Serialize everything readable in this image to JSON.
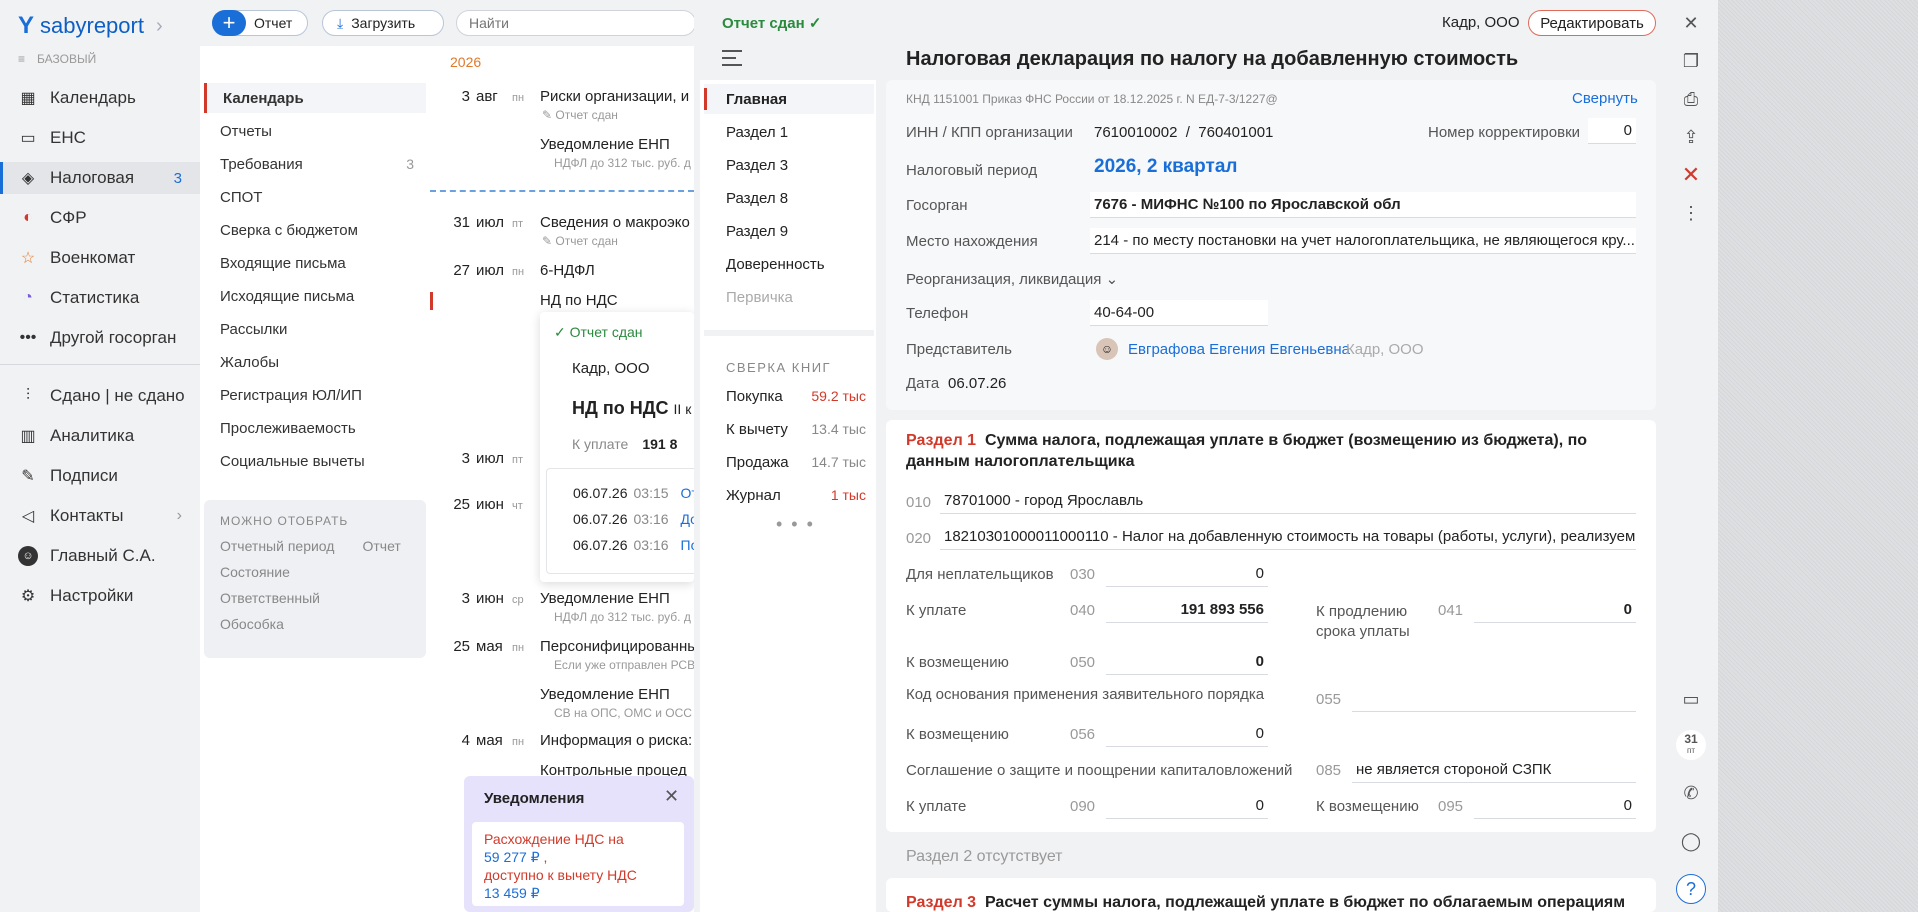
{
  "nav": {
    "logo_a": "sabyreport",
    "logo_b": "",
    "tariff": "БАЗОВЫЙ",
    "items": [
      {
        "label": "Календарь",
        "icon": "calendar-icon",
        "count": ""
      },
      {
        "label": "ЕНС",
        "icon": "wallet-icon",
        "count": ""
      },
      {
        "label": "Налоговая",
        "icon": "tax-icon",
        "count": "3"
      },
      {
        "label": "СФР",
        "icon": "sfr-icon",
        "count": ""
      },
      {
        "label": "Военкомат",
        "icon": "star-icon",
        "count": ""
      },
      {
        "label": "Статистика",
        "icon": "pie-chart-icon",
        "count": ""
      },
      {
        "label": "Другой госорган",
        "icon": "more-icon",
        "count": ""
      }
    ],
    "items2": [
      {
        "label": "Сдано | не сдано",
        "icon": "sliders-icon"
      },
      {
        "label": "Аналитика",
        "icon": "bar-chart-icon"
      },
      {
        "label": "Подписи",
        "icon": "signature-icon"
      },
      {
        "label": "Контакты",
        "icon": "contacts-icon"
      },
      {
        "label": "Главный С.А.",
        "icon": "avatar"
      },
      {
        "label": "Настройки",
        "icon": "gear-icon"
      }
    ]
  },
  "topbar": {
    "report_btn": "Отчет",
    "upload_btn": "Загрузить",
    "search_placeholder": "Найти"
  },
  "submenu": {
    "items": [
      {
        "label": "Календарь",
        "count": ""
      },
      {
        "label": "Отчеты",
        "count": ""
      },
      {
        "label": "Требования",
        "count": "3"
      },
      {
        "label": "СПОТ",
        "count": ""
      },
      {
        "label": "Сверка с бюджетом",
        "count": ""
      },
      {
        "label": "Входящие письма",
        "count": ""
      },
      {
        "label": "Исходящие письма",
        "count": ""
      },
      {
        "label": "Рассылки",
        "count": ""
      },
      {
        "label": "Жалобы",
        "count": ""
      },
      {
        "label": "Регистрация ЮЛ/ИП",
        "count": ""
      },
      {
        "label": "Прослеживаемость",
        "count": ""
      },
      {
        "label": "Социальные вычеты",
        "count": ""
      }
    ],
    "filters_title": "МОЖНО ОТОБРАТЬ",
    "filters": [
      "Отчетный период",
      "Отчет",
      "Состояние",
      "Ответственный",
      "Обособка"
    ]
  },
  "list": {
    "year": "2026",
    "events": [
      {
        "day": "3",
        "mon": "авг",
        "wd": "пн",
        "title": "Риски организации, и",
        "sub": "Отчет сдан"
      },
      {
        "title": "Уведомление ЕНП",
        "sub": "НДФЛ до 312 тыс. руб. д"
      },
      {
        "day": "31",
        "mon": "июл",
        "wd": "пт",
        "title": "Сведения о макроэко",
        "sub": "Отчет сдан"
      },
      {
        "day": "27",
        "mon": "июл",
        "wd": "пн",
        "title": "6-НДФЛ",
        "sub": ""
      },
      {
        "title": "НД по НДС",
        "sub": ""
      },
      {
        "day": "3",
        "mon": "июл",
        "wd": "пт",
        "title": "",
        "sub": ""
      },
      {
        "day": "25",
        "mon": "июн",
        "wd": "чт",
        "title": "",
        "sub": ""
      },
      {
        "day": "3",
        "mon": "июн",
        "wd": "ср",
        "title": "Уведомление ЕНП",
        "sub": "НДФЛ до 312 тыс. руб. д"
      },
      {
        "day": "25",
        "mon": "мая",
        "wd": "пн",
        "title": "Персонифицированны",
        "sub": "Если уже отправлен РСВ"
      },
      {
        "title": "Уведомление ЕНП",
        "sub": "СВ на ОПС, ОМС и ОСС"
      },
      {
        "day": "4",
        "mon": "мая",
        "wd": "пн",
        "title": "Информация о риска:",
        "sub": ""
      },
      {
        "title": "Контрольные процед",
        "sub": ""
      }
    ]
  },
  "popup": {
    "status": "✓ Отчет сдан",
    "org": "Кадр, ООО",
    "title": "НД по НДС",
    "title_small": "II к",
    "pay_label": "К уплате",
    "pay_value": "191 8",
    "log": [
      {
        "date": "06.07.26",
        "time": "03:15",
        "what": "От"
      },
      {
        "date": "06.07.26",
        "time": "03:16",
        "what": "До"
      },
      {
        "date": "06.07.26",
        "time": "03:16",
        "what": "По"
      }
    ]
  },
  "notif": {
    "title": "Уведомления",
    "l1": "Расхождение НДС на",
    "l2": "59 277 ₽",
    "l2b": ",",
    "l3": "доступно к вычету НДС",
    "l4": "13 459 ₽"
  },
  "panel": {
    "status": "Отчет сдан ✓",
    "org": "Кадр, ООО",
    "edit_btn": "Редактировать",
    "title": "Налоговая декларация по налогу на добавленную стоимость",
    "sections": [
      "Главная",
      "Раздел 1",
      "Раздел 3",
      "Раздел 8",
      "Раздел 9",
      "Доверенность",
      "Первичка"
    ],
    "books_title": "СВЕРКА КНИГ",
    "books": [
      {
        "label": "Покупка",
        "value": "59.2 тыс",
        "color": "#d13a2a"
      },
      {
        "label": "К вычету",
        "value": "13.4 тыс",
        "color": "#888888"
      },
      {
        "label": "Продажа",
        "value": "14.7 тыс",
        "color": "#888888"
      },
      {
        "label": "Журнал",
        "value": "1 тыс",
        "color": "#d13a2a"
      }
    ],
    "more_dots": "• • •"
  },
  "main": {
    "meta": "КНД 1151001 Приказ ФНС России от 18.12.2025 г. N ЕД-7-3/1227@",
    "collapse": "Свернуть",
    "inn_label": "ИНН / КПП организации",
    "inn": "7610010002",
    "slash": "/",
    "kpp": "760401001",
    "corr_label": "Номер корректировки",
    "corr": "0",
    "period_label": "Налоговый период",
    "period": "2026, 2 квартал",
    "gos_label": "Госорган",
    "gos": "7676 - МИФНС №100 по Ярославской обл",
    "place_label": "Место нахождения",
    "place": "214 - по месту постановки на учет налогоплательщика, не являющегося кру...",
    "reorg_label": "Реорганизация, ликвидация",
    "phone_label": "Телефон",
    "phone": "40-64-00",
    "rep_label": "Представитель",
    "rep_name": "Евграфова Евгения Евгеньевна",
    "rep_org": "Кадр, ООО",
    "date_label": "Дата",
    "date": "06.07.26",
    "s1_num": "Раздел 1",
    "s1_title": "Сумма налога, подлежащая уплате в бюджет (возмещению из бюджета), по данным налогоплательщика",
    "r010_code": "010",
    "r010": "78701000 - город Ярославль",
    "r020_code": "020",
    "r020": "18210301000011000110 - Налог на добавленную стоимость на товары (работы, услуги), реализуем...",
    "r030_label": "Для неплательщиков",
    "r030_code": "030",
    "r030": "0",
    "r040_label": "К уплате",
    "r040_code": "040",
    "r040": "191 893 556",
    "r041_label": "К продлению срока уплаты",
    "r041_code": "041",
    "r041": "0",
    "r050_label": "К возмещению",
    "r050_code": "050",
    "r050": "0",
    "r055_label": "Код основания применения заявительного порядка",
    "r055_code": "055",
    "r055": "",
    "r056_label": "К возмещению",
    "r056_code": "056",
    "r056": "0",
    "r085_label": "Соглашение о защите и поощрении капиталовложений",
    "r085_code": "085",
    "r085": "не является стороной СЗПК",
    "r090_label": "К уплате",
    "r090_code": "090",
    "r090": "0",
    "r095_label": "К возмещению",
    "r095_code": "095",
    "r095": "0",
    "s2_absent": "Раздел 2 отсутствует",
    "s3_num": "Раздел 3",
    "s3_title": "Расчет суммы налога, подлежащей уплате в бюджет по облагаемым операциям"
  },
  "rtool": {
    "cal_day": "31",
    "cal_wd": "пт",
    "help": "?"
  }
}
